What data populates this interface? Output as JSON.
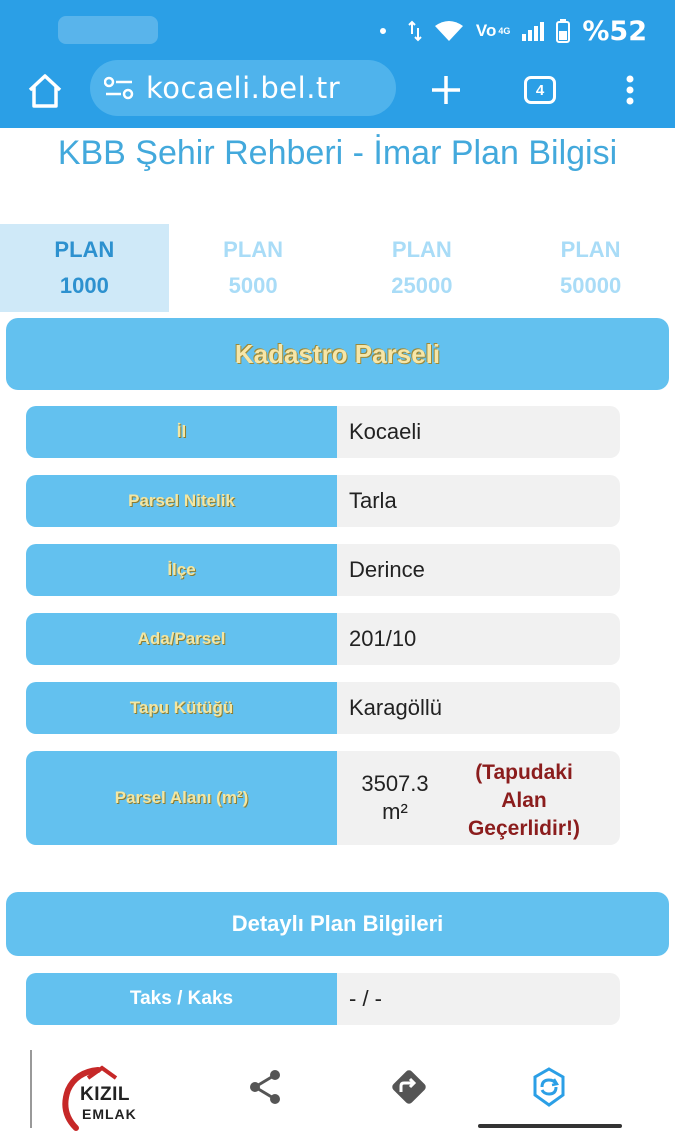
{
  "status": {
    "battery_text": "%52",
    "network_label": "Vo",
    "network_sub": "4G"
  },
  "browser": {
    "url": "kocaeli.bel.tr",
    "tab_count": "4"
  },
  "page": {
    "title": "KBB Şehir Rehberi - İmar Plan Bilgisi",
    "plan_tabs": [
      {
        "line1": "PLAN",
        "line2": "1000",
        "active": true
      },
      {
        "line1": "PLAN",
        "line2": "5000",
        "active": false
      },
      {
        "line1": "PLAN",
        "line2": "25000",
        "active": false
      },
      {
        "line1": "PLAN",
        "line2": "50000",
        "active": false
      }
    ],
    "kadastro_header": "Kadastro Parseli",
    "rows": [
      {
        "label": "İl",
        "value": "Kocaeli"
      },
      {
        "label": "Parsel Nitelik",
        "value": "Tarla"
      },
      {
        "label": "İlçe",
        "value": "Derince"
      },
      {
        "label": "Ada/Parsel",
        "value": "201/10"
      },
      {
        "label": "Tapu Kütüğü",
        "value": "Karagöllü"
      }
    ],
    "area_row": {
      "label": "Parsel Alanı (m²)",
      "value_line1": "3507.3",
      "value_line2": "m²",
      "note_line1": "(Tapudaki",
      "note_line2": "Alan",
      "note_line3": "Geçerlidir!)"
    },
    "detail_header": "Detaylı Plan Bilgileri",
    "taks_row": {
      "label": "Taks / Kaks",
      "value": "- / -"
    }
  },
  "bottom": {
    "logo_line1": "KIZIL",
    "logo_line2": "EMLAK"
  },
  "colors": {
    "toolbar": "#2b9fe6",
    "header": "#63c1ef",
    "title": "#43a9dc",
    "note": "#8b1d1d"
  }
}
